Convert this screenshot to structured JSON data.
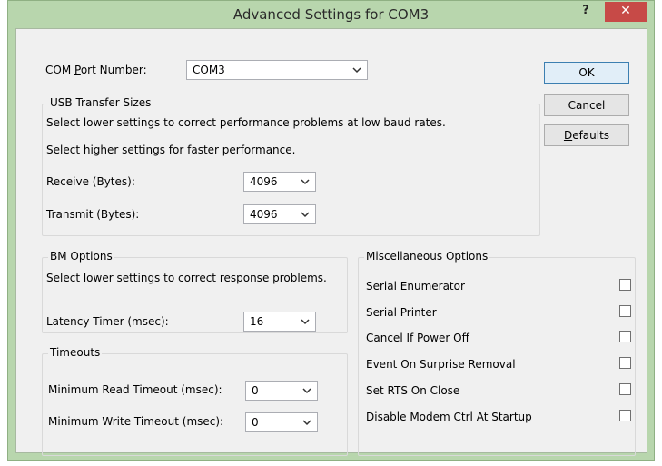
{
  "window": {
    "title": "Advanced Settings for COM3",
    "help_label": "?",
    "close_label": "✕"
  },
  "com_port": {
    "label_prefix": "COM ",
    "label_u": "P",
    "label_suffix": "ort Number:",
    "value": "COM3"
  },
  "usb": {
    "title": "USB Transfer Sizes",
    "hint_low": "Select lower settings to correct performance problems at low baud rates.",
    "hint_high": "Select higher settings for faster performance.",
    "receive_label": "Receive (Bytes):",
    "receive_value": "4096",
    "transmit_label": "Transmit (Bytes):",
    "transmit_value": "4096"
  },
  "bm": {
    "title": "BM Options",
    "hint": "Select lower settings to correct response problems.",
    "latency_label": "Latency Timer (msec):",
    "latency_value": "16"
  },
  "timeouts": {
    "title": "Timeouts",
    "read_label": "Minimum Read Timeout (msec):",
    "read_value": "0",
    "write_label": "Minimum Write Timeout (msec):",
    "write_value": "0"
  },
  "misc": {
    "title": "Miscellaneous Options",
    "items": [
      {
        "label": "Serial Enumerator",
        "checked": false
      },
      {
        "label": "Serial Printer",
        "checked": false
      },
      {
        "label": "Cancel If Power Off",
        "checked": false
      },
      {
        "label": "Event On Surprise Removal",
        "checked": false
      },
      {
        "label": "Set RTS On Close",
        "checked": false
      },
      {
        "label": "Disable Modem Ctrl At Startup",
        "checked": false
      }
    ]
  },
  "buttons": {
    "ok": "OK",
    "cancel": "Cancel",
    "defaults_u": "D",
    "defaults_rest": "efaults"
  },
  "colors": {
    "frame": "#b8d6ad",
    "close": "#c74a47",
    "client": "#f0f0f0"
  }
}
